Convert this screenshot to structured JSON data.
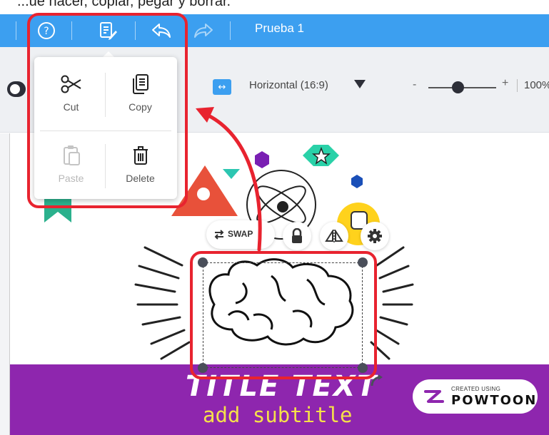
{
  "top_strip": {
    "partial_text": "...ue hacer, copiar, pegar y borrar."
  },
  "header": {
    "help_icon": "question-circle-icon",
    "edit_icon": "edit-document-icon",
    "undo_icon": "undo-icon",
    "redo_icon": "redo-icon",
    "document_title": "Prueba 1"
  },
  "toolbar": {
    "aspect_ratio_label": "Horizontal (16:9)",
    "zoom_minus": "-",
    "zoom_plus": "+",
    "zoom_value": "100%"
  },
  "edit_menu": {
    "items": [
      {
        "label": "Cut",
        "icon": "scissors-icon",
        "enabled": true
      },
      {
        "label": "Copy",
        "icon": "copy-icon",
        "enabled": true
      },
      {
        "label": "Paste",
        "icon": "paste-icon",
        "enabled": false
      },
      {
        "label": "Delete",
        "icon": "trash-icon",
        "enabled": true
      }
    ]
  },
  "canvas": {
    "swap_label": "SWAP",
    "title_text": "TITLE TEXT",
    "subtitle_text": "add subtitle",
    "badge_created": "CREATED USING",
    "badge_brand": "POWTOON"
  },
  "colors": {
    "header_blue": "#3c9ff0",
    "annotation_red": "#e8232f",
    "banner_purple": "#8e26ae",
    "subtitle_yellow": "#f5e04a"
  }
}
